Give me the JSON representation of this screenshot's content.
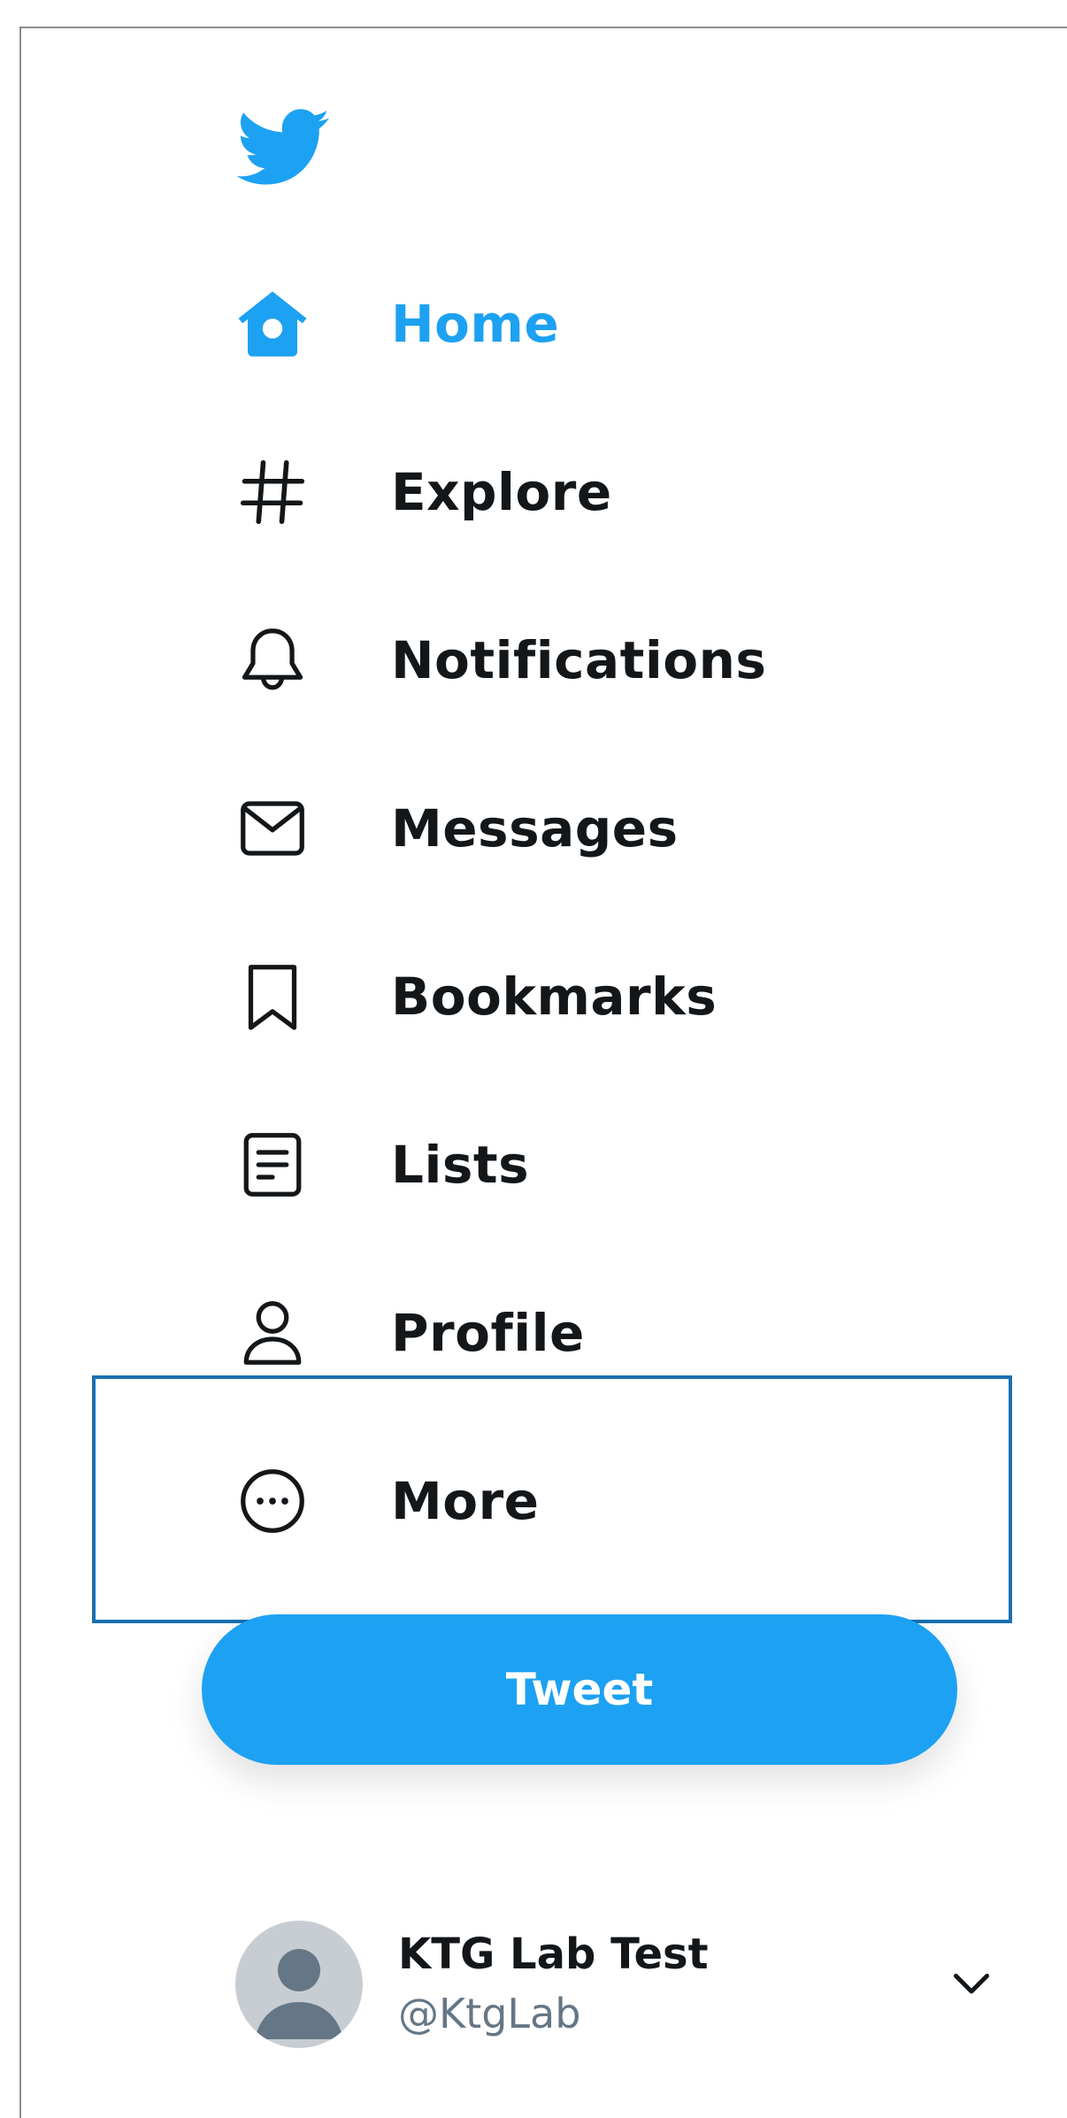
{
  "colors": {
    "brand": "#1da1f2",
    "text": "#14171a",
    "secondary_text": "#657786",
    "highlight_border": "#1a6fb0"
  },
  "logo": {
    "icon": "twitter-bird-icon"
  },
  "nav": {
    "items": [
      {
        "label": "Home",
        "icon": "home-icon",
        "active": true
      },
      {
        "label": "Explore",
        "icon": "hashtag-icon",
        "active": false
      },
      {
        "label": "Notifications",
        "icon": "bell-icon",
        "active": false
      },
      {
        "label": "Messages",
        "icon": "envelope-icon",
        "active": false
      },
      {
        "label": "Bookmarks",
        "icon": "bookmark-icon",
        "active": false
      },
      {
        "label": "Lists",
        "icon": "list-icon",
        "active": false
      },
      {
        "label": "Profile",
        "icon": "person-icon",
        "active": false
      },
      {
        "label": "More",
        "icon": "more-circle-icon",
        "active": false
      }
    ]
  },
  "tweet_button": {
    "label": "Tweet"
  },
  "account": {
    "name": "KTG Lab Test",
    "handle": "@KtgLab",
    "avatar_icon": "default-avatar-icon",
    "menu_icon": "chevron-down-icon"
  }
}
